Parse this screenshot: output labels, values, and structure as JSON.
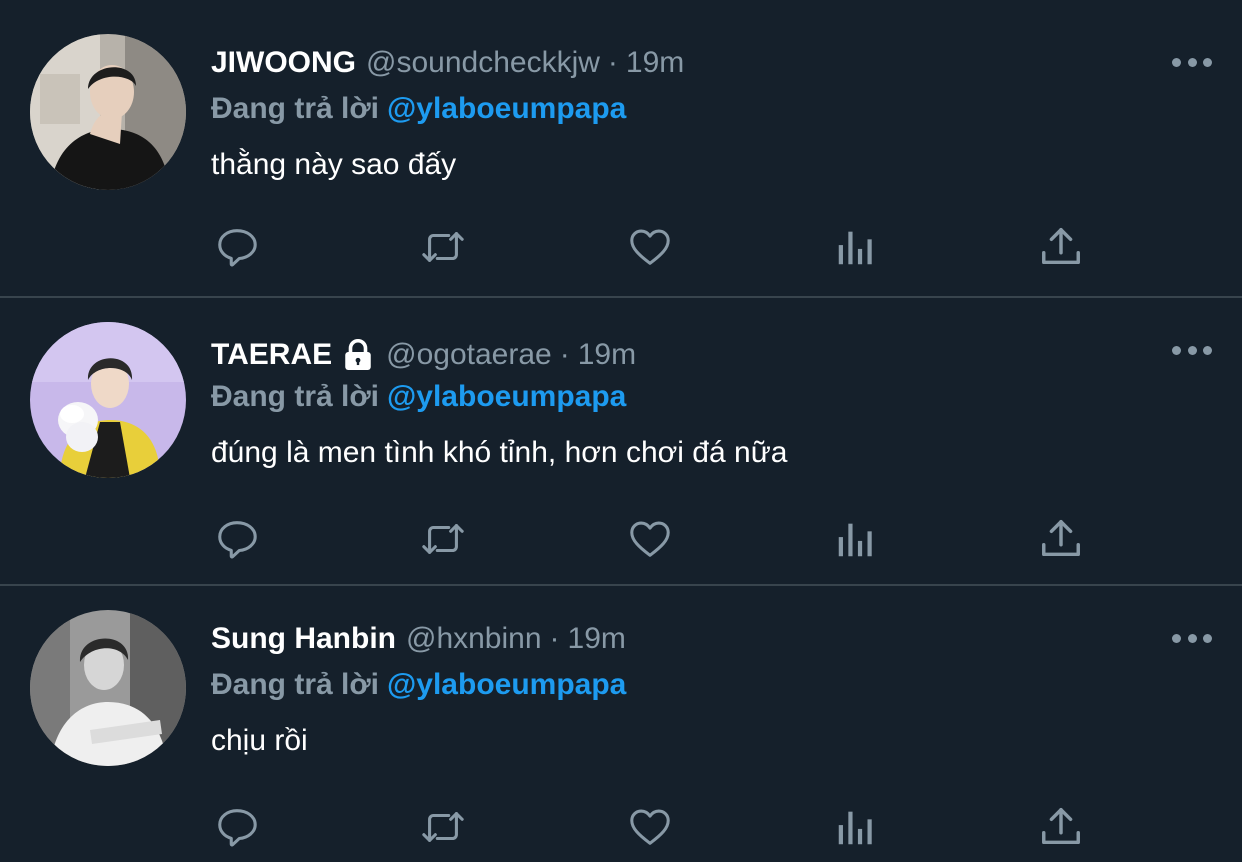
{
  "colors": {
    "background": "#15202b",
    "divider": "#38444d",
    "muted": "#8899a6",
    "accent": "#1d9bf0",
    "text": "#ffffff"
  },
  "tweets": [
    {
      "name": "JIWOONG",
      "handle": "@soundcheckkjw",
      "dot": "·",
      "time": "19m",
      "locked": false,
      "reply_prefix": "Đang trả lời",
      "reply_target": "@ylaboeumpapa",
      "text": "thằng này sao đấy"
    },
    {
      "name": "TAERAE",
      "handle": "@ogotaerae",
      "dot": "·",
      "time": "19m",
      "locked": true,
      "reply_prefix": "Đang trả lời",
      "reply_target": "@ylaboeumpapa",
      "text": "đúng là men tình khó tỉnh, hơn chơi đá nữa"
    },
    {
      "name": "Sung Hanbin",
      "handle": "@hxnbinn",
      "dot": "·",
      "time": "19m",
      "locked": false,
      "reply_prefix": "Đang trả lời",
      "reply_target": "@ylaboeumpapa",
      "text": "chịu rồi"
    }
  ],
  "icons": {
    "reply": "reply-icon",
    "retweet": "retweet-icon",
    "like": "heart-icon",
    "stats": "analytics-icon",
    "share": "share-icon",
    "more": "more-icon",
    "lock": "lock-icon"
  }
}
